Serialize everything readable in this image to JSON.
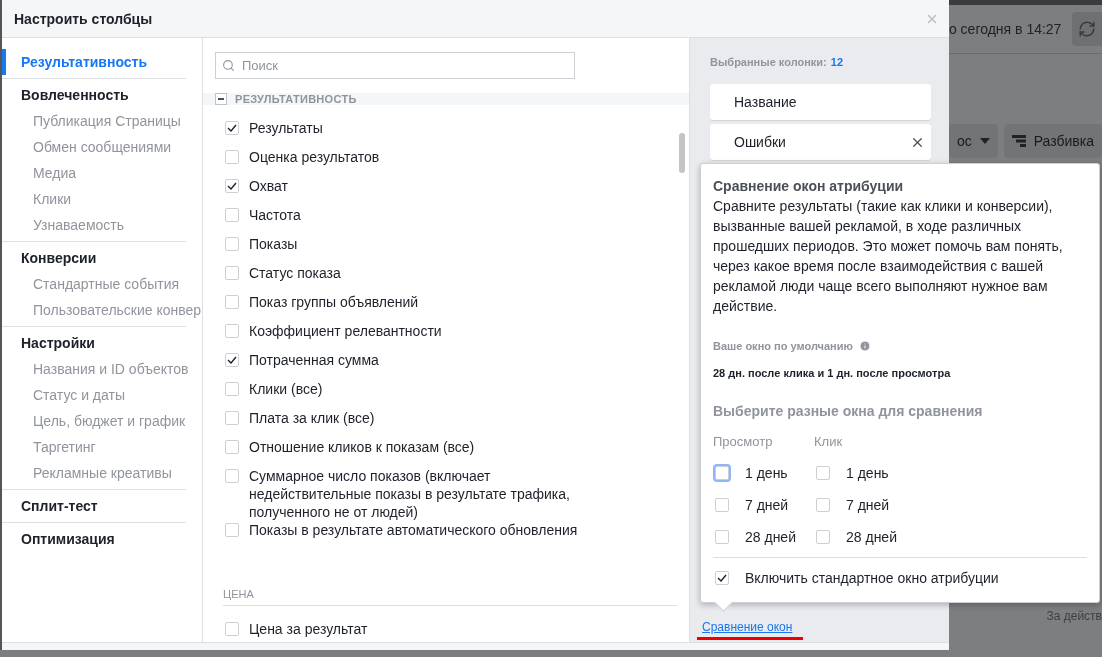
{
  "dialog": {
    "title": "Настроить столбцы"
  },
  "sidebar": [
    {
      "label": "Результативность",
      "selected": true
    },
    {
      "label": "Вовлеченность",
      "selected": false,
      "children": [
        {
          "label": "Публикация Страницы",
          "selected": false
        },
        {
          "label": "Обмен сообщениями",
          "selected": false
        },
        {
          "label": "Медиа",
          "selected": false
        },
        {
          "label": "Клики",
          "selected": false
        },
        {
          "label": "Узнаваемость",
          "selected": false
        }
      ]
    },
    {
      "label": "Конверсии",
      "selected": false,
      "children": [
        {
          "label": "Стандартные события",
          "selected": false
        },
        {
          "label": "Пользовательские конвер",
          "selected": false
        }
      ]
    },
    {
      "label": "Настройки",
      "selected": false,
      "children": [
        {
          "label": "Названия и ID объектов",
          "selected": false
        },
        {
          "label": "Статус и даты",
          "selected": false
        },
        {
          "label": "Цель, бюджет и график",
          "selected": false
        },
        {
          "label": "Таргетинг",
          "selected": false
        },
        {
          "label": "Рекламные креативы",
          "selected": false
        }
      ]
    },
    {
      "label": "Сплит-тест",
      "selected": false
    },
    {
      "label": "Оптимизация",
      "selected": false
    }
  ],
  "search": {
    "placeholder": "Поиск"
  },
  "sections": [
    {
      "kind": "collapsible",
      "title": "РЕЗУЛЬТАТИВНОСТЬ",
      "expanded": true,
      "items": [
        {
          "label": "Результаты",
          "checked": true
        },
        {
          "label": "Оценка результатов",
          "checked": false
        },
        {
          "label": "Охват",
          "checked": true
        },
        {
          "label": "Частота",
          "checked": false
        },
        {
          "label": "Показы",
          "checked": false
        },
        {
          "label": "Статус показа",
          "checked": false
        },
        {
          "label": "Показ группы объявлений",
          "checked": false
        },
        {
          "label": "Коэффициент релевантности",
          "checked": false
        },
        {
          "label": "Потраченная сумма",
          "checked": true
        },
        {
          "label": "Клики (все)",
          "checked": false
        },
        {
          "label": "Плата за клик (все)",
          "checked": false
        },
        {
          "label": "Отношение кликов к показам (все)",
          "checked": false
        },
        {
          "label": "Суммарное число показов (включает недействительные показы в результате трафика, полученного не от людей)",
          "checked": false
        },
        {
          "label": "Показы в результате автоматического обновления",
          "checked": false
        }
      ]
    },
    {
      "kind": "plain",
      "title": "ЦЕНА",
      "items": [
        {
          "label": "Цена за результат",
          "checked": false
        }
      ]
    }
  ],
  "selected_columns": {
    "label": "Выбранные колонки:",
    "count": "12",
    "items": [
      {
        "name": "Название",
        "removable": false
      },
      {
        "name": "Ошибки",
        "removable": true
      }
    ]
  },
  "link": "Сравнение окон",
  "popover": {
    "title": "Сравнение окон атрибуции",
    "text": "Сравните результаты (такие как клики и конверсии), вызванные вашей рекламой, в ходе различных прошедших периодов. Это может помочь вам понять, через какое время после взаимодействия с вашей рекламой люди чаще всего выполняют нужное вам действие.",
    "default_label": "Ваше окно по умолчанию",
    "default_value": "28 дн. после клика и 1 дн. после просмотра",
    "compare_title": "Выберите разные окна для сравнения",
    "columns": [
      {
        "heading": "Просмотр",
        "options": [
          {
            "label": "1 день",
            "checked": false,
            "focused": true
          },
          {
            "label": "7 дней",
            "checked": false,
            "focused": false
          },
          {
            "label": "28 дней",
            "checked": false,
            "focused": false
          }
        ]
      },
      {
        "heading": "Клик",
        "options": [
          {
            "label": "1 день",
            "checked": false,
            "focused": false
          },
          {
            "label": "7 дней",
            "checked": false,
            "focused": false
          },
          {
            "label": "28 дней",
            "checked": false,
            "focused": false
          }
        ]
      }
    ],
    "standard": {
      "label": "Включить стандартное окно атрибуции",
      "checked": true
    }
  },
  "background": {
    "updated": "о сегодня в 14:27",
    "dropdown": "ос",
    "breakdown": "Разбивка",
    "footer": "За действ"
  }
}
